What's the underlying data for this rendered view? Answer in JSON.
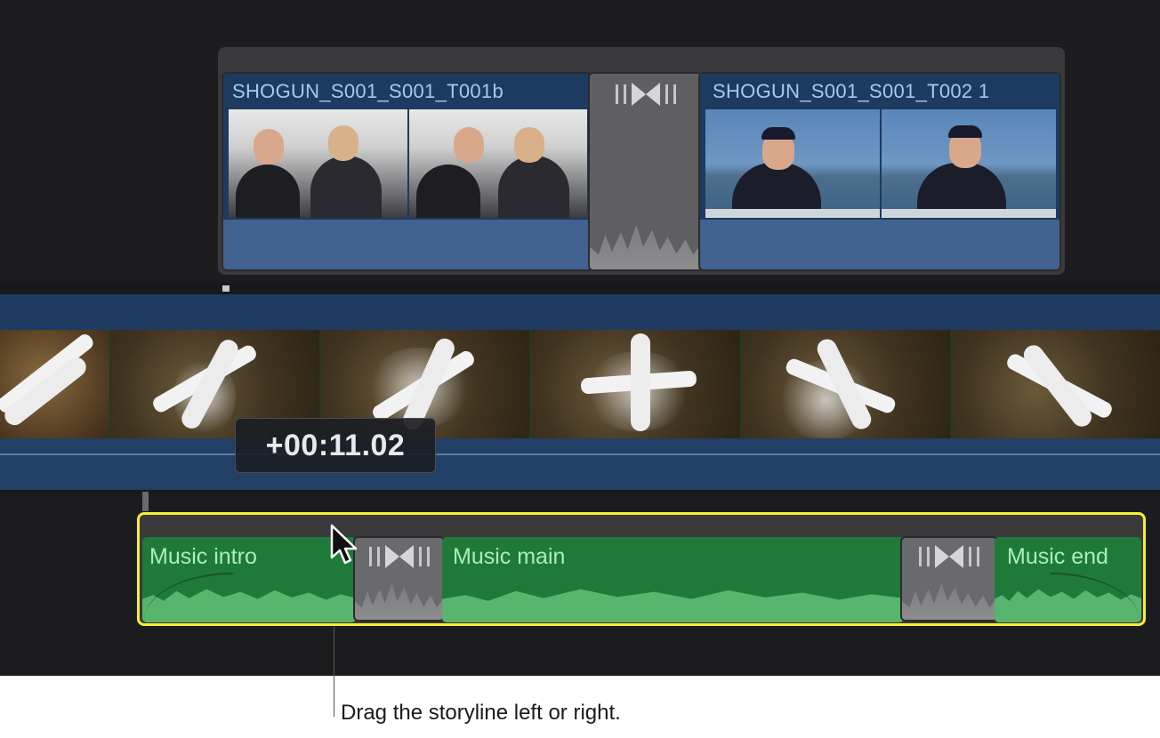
{
  "connected_clips": {
    "left_clip_title": "SHOGUN_S001_S001_T001b",
    "right_clip_title": "SHOGUN_S001_S001_T002 1"
  },
  "timecode": "+00:11.02",
  "music_storyline": {
    "intro_label": "Music intro",
    "main_label": "Music main",
    "end_label": "Music end"
  },
  "caption": "Drag the storyline left or right.",
  "colors": {
    "selection_outline": "#f6ee35",
    "video_clip": "#1d3a60",
    "audio_clip": "#1f7a3a"
  }
}
